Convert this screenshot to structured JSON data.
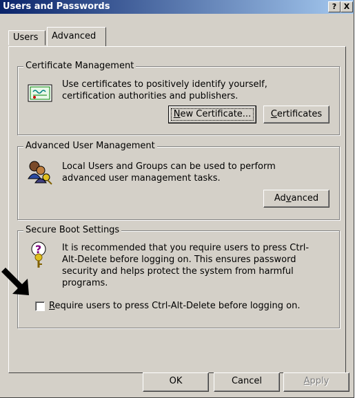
{
  "window": {
    "title": "Users and Passwords",
    "help": "?",
    "close": "X"
  },
  "tabs": [
    {
      "label": "Users"
    },
    {
      "label": "Advanced"
    }
  ],
  "certificate_management": {
    "legend": "Certificate Management",
    "description": "Use certificates to positively identify yourself, certification authorities and publishers.",
    "new_certificate_pre": "N",
    "new_certificate_rest": "ew Certificate...",
    "certificates_pre": "C",
    "certificates_rest": "ertificates"
  },
  "advanced_user_management": {
    "legend": "Advanced User Management",
    "description": "Local Users and Groups can be used to perform advanced user management tasks.",
    "advanced_pre": "Ad",
    "advanced_u": "v",
    "advanced_post": "anced"
  },
  "secure_boot": {
    "legend": "Secure Boot Settings",
    "description": "It is recommended that you require users to press Ctrl-Alt-Delete before logging on. This ensures password security and helps protect the system from harmful programs.",
    "checkbox_u": "R",
    "checkbox_rest": "equire users to press Ctrl-Alt-Delete before logging on.",
    "checked": false
  },
  "footer": {
    "ok": "OK",
    "cancel": "Cancel",
    "apply_u": "A",
    "apply_rest": "pply"
  }
}
